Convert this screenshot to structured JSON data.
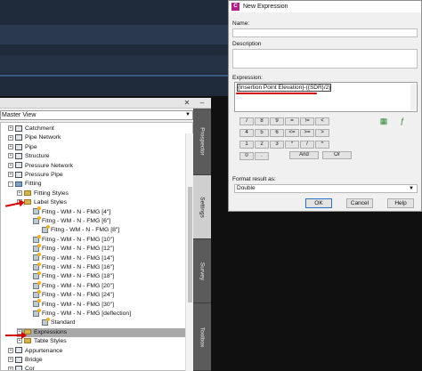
{
  "toolspace": {
    "view": "Master View",
    "side_tabs": [
      "Prospector",
      "Settings",
      "Survey",
      "Toolbox"
    ],
    "tree": [
      {
        "label": "Catchment",
        "indent": 0,
        "expander": "+",
        "icon": "catchment-icon"
      },
      {
        "label": "Pipe Network",
        "indent": 0,
        "expander": "+",
        "icon": "pipe-network-icon"
      },
      {
        "label": "Pipe",
        "indent": 0,
        "expander": "+",
        "icon": "pipe-icon"
      },
      {
        "label": "Structure",
        "indent": 0,
        "expander": "+",
        "icon": "structure-icon"
      },
      {
        "label": "Pressure Network",
        "indent": 0,
        "expander": "+",
        "icon": "pressure-network-icon"
      },
      {
        "label": "Pressure Pipe",
        "indent": 0,
        "expander": "+",
        "icon": "pressure-pipe-icon"
      },
      {
        "label": "Fitting",
        "indent": 0,
        "expander": "-",
        "icon": "fitting-icon"
      },
      {
        "label": "Fitting Styles",
        "indent": 1,
        "expander": "+",
        "icon": "folder-icon"
      },
      {
        "label": "Label Styles",
        "indent": 1,
        "expander": "-",
        "icon": "folder-icon"
      },
      {
        "label": "Fitng - WM - N  -  FMG [4\"]",
        "indent": 2,
        "expander": "",
        "icon": "label-style-icon"
      },
      {
        "label": "Fitng - WM - N  -  FMG [6\"]",
        "indent": 2,
        "expander": "",
        "icon": "label-style-icon"
      },
      {
        "label": "Fitng - WM - N  -  FMG [8\"]",
        "indent": 3,
        "expander": "",
        "icon": "label-style-icon"
      },
      {
        "label": "Fitng - WM - N  -  FMG [10\"]",
        "indent": 2,
        "expander": "",
        "icon": "label-style-icon"
      },
      {
        "label": "Fitng - WM - N  -  FMG [12\"]",
        "indent": 2,
        "expander": "",
        "icon": "label-style-icon"
      },
      {
        "label": "Fitng - WM - N  -  FMG [14\"]",
        "indent": 2,
        "expander": "",
        "icon": "label-style-icon"
      },
      {
        "label": "Fitng - WM - N  -  FMG [16\"]",
        "indent": 2,
        "expander": "",
        "icon": "label-style-icon"
      },
      {
        "label": "Fitng - WM - N  -  FMG [18\"]",
        "indent": 2,
        "expander": "",
        "icon": "label-style-icon"
      },
      {
        "label": "Fitng - WM - N  -  FMG [20\"]",
        "indent": 2,
        "expander": "",
        "icon": "label-style-icon"
      },
      {
        "label": "Fitng - WM - N  -  FMG [24\"]",
        "indent": 2,
        "expander": "",
        "icon": "label-style-icon"
      },
      {
        "label": "Fitng - WM - N  -  FMG [30\"]",
        "indent": 2,
        "expander": "",
        "icon": "label-style-icon"
      },
      {
        "label": "Fitng - WM - N  -  FMG [deflection]",
        "indent": 2,
        "expander": "",
        "icon": "label-style-icon"
      },
      {
        "label": "Standard",
        "indent": 3,
        "expander": "",
        "icon": "label-style-icon"
      },
      {
        "label": "Expressions",
        "indent": 1,
        "expander": "+",
        "icon": "folder-icon",
        "selected": true
      },
      {
        "label": "Table Styles",
        "indent": 1,
        "expander": "+",
        "icon": "folder-icon"
      },
      {
        "label": "Appurtenance",
        "indent": 0,
        "expander": "+",
        "icon": "appurtenance-icon"
      },
      {
        "label": "Bridge",
        "indent": 0,
        "expander": "+",
        "icon": "bridge-icon"
      },
      {
        "label": "Cor",
        "indent": 0,
        "expander": "+",
        "icon": "corridor-icon"
      }
    ]
  },
  "dialog": {
    "title": "New Expression",
    "name_label": "Name:",
    "name_value": "",
    "description_label": "Description",
    "description_value": "",
    "expression_label": "Expression:",
    "expression_text": "{Insertion Point Elevation}-({SDR}/2)",
    "calc_buttons": [
      [
        "7",
        "8",
        "9",
        "=",
        "!=",
        "<"
      ],
      [
        "4",
        "5",
        "6",
        "<=",
        ">=",
        ">"
      ],
      [
        "1",
        "2",
        "3",
        "*",
        "/",
        "^"
      ],
      [
        "0",
        ".",
        "+",
        "-",
        "(",
        ")"
      ]
    ],
    "logic_buttons": [
      "And",
      "Or"
    ],
    "format_label": "Format result as:",
    "format_value": "Double",
    "ok_label": "OK",
    "cancel_label": "Cancel",
    "help_label": "Help"
  }
}
